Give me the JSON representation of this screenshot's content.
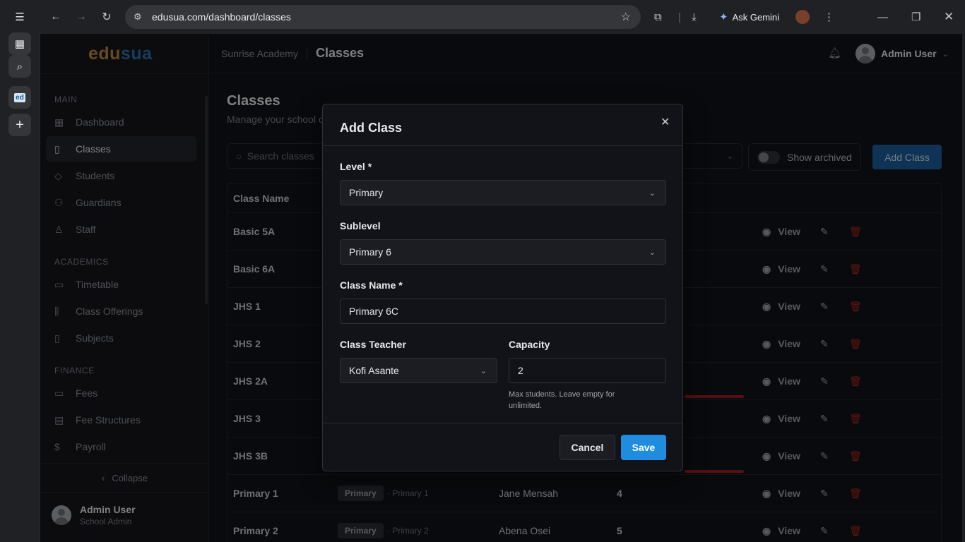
{
  "browser": {
    "url": "edusua.com/dashboard/classes",
    "ask_gemini": "Ask Gemini"
  },
  "app": {
    "logo_part1": "edu",
    "logo_part2": "sua",
    "school": "Sunrise Academy",
    "section": "Classes",
    "header_user": "Admin User"
  },
  "sidebar": {
    "main_label": "MAIN",
    "academics_label": "ACADEMICS",
    "finance_label": "FINANCE",
    "items": [
      {
        "label": "Dashboard",
        "icon": "dashboard-icon"
      },
      {
        "label": "Classes",
        "icon": "book-icon"
      },
      {
        "label": "Students",
        "icon": "graduation-cap-icon"
      },
      {
        "label": "Guardians",
        "icon": "users-icon"
      },
      {
        "label": "Staff",
        "icon": "staff-icon"
      },
      {
        "label": "Timetable",
        "icon": "calendar-icon"
      },
      {
        "label": "Class Offerings",
        "icon": "library-icon"
      },
      {
        "label": "Subjects",
        "icon": "book-open-icon"
      },
      {
        "label": "Fees",
        "icon": "wallet-icon"
      },
      {
        "label": "Fee Structures",
        "icon": "clipboard-icon"
      },
      {
        "label": "Payroll",
        "icon": "dollar-icon"
      }
    ],
    "collapse": "Collapse",
    "user_name": "Admin User",
    "user_role": "School Admin"
  },
  "page": {
    "title": "Classes",
    "subtitle": "Manage your school c",
    "search_placeholder": "Search classes",
    "show_archived": "Show archived",
    "add_class": "Add Class"
  },
  "table": {
    "col_class_name": "Class Name",
    "view_label": "View",
    "rows": [
      {
        "name": "Basic 5A"
      },
      {
        "name": "Basic 6A"
      },
      {
        "name": "JHS 1"
      },
      {
        "name": "JHS 2"
      },
      {
        "name": "JHS 2A"
      },
      {
        "name": "JHS 3"
      },
      {
        "name": "JHS 3B"
      },
      {
        "name": "Primary 1",
        "level": "Primary",
        "sublevel": "· Primary 1",
        "teacher": "Jane Mensah",
        "capacity": "4"
      },
      {
        "name": "Primary 2",
        "level": "Primary",
        "sublevel": "· Primary 2",
        "teacher": "Abena Osei",
        "capacity": "5"
      }
    ]
  },
  "modal": {
    "title": "Add Class",
    "level_label": "Level *",
    "level_value": "Primary",
    "sublevel_label": "Sublevel",
    "sublevel_value": "Primary 6",
    "class_name_label": "Class Name *",
    "class_name_value": "Primary 6C",
    "teacher_label": "Class Teacher",
    "teacher_value": "Kofi Asante",
    "capacity_label": "Capacity",
    "capacity_value": "2",
    "capacity_help": "Max students. Leave empty for unlimited.",
    "cancel": "Cancel",
    "save": "Save"
  },
  "colors": {
    "accent": "#1f8ce0",
    "danger": "#b3261e",
    "logo_gold": "#b8893b",
    "logo_blue": "#2b6fb3"
  }
}
